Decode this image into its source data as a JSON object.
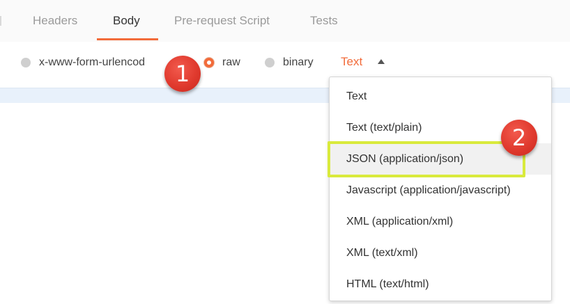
{
  "tabs": [
    {
      "label": "Headers",
      "active": false
    },
    {
      "label": "Body",
      "active": true
    },
    {
      "label": "Pre-request Script",
      "active": false
    },
    {
      "label": "Tests",
      "active": false
    }
  ],
  "body_types": {
    "urlencoded_label": "x-www-form-urlencod",
    "raw_label": "raw",
    "binary_label": "binary",
    "selected": "raw",
    "content_type_value": "Text"
  },
  "dropdown": {
    "items": [
      "Text",
      "Text (text/plain)",
      "JSON (application/json)",
      "Javascript (application/javascript)",
      "XML (application/xml)",
      "XML (text/xml)",
      "HTML (text/html)"
    ],
    "highlighted_item": "JSON (application/json)"
  },
  "annotations": {
    "step1": "1",
    "step2": "2"
  },
  "colors": {
    "accent": "#f26b3a",
    "highlight_box": "#d9ea3c",
    "badge": "#e03a2e",
    "editor_strip": "#e8f1fb"
  }
}
